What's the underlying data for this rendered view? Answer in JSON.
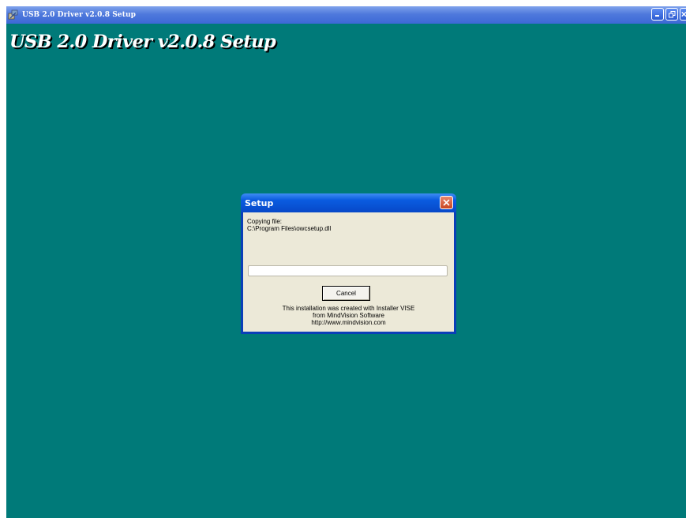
{
  "window": {
    "title": "USB 2.0 Driver v2.0.8 Setup",
    "background_color": "#007a79",
    "controls": [
      "minimize-icon",
      "restore-icon",
      "close-icon"
    ]
  },
  "heading": {
    "text": "USB 2.0 Driver v2.0.8 Setup"
  },
  "dialog": {
    "title": "Setup",
    "copying_label": "Copying file:",
    "file_path": "C:\\Program Files\\owcsetup.dll",
    "progress": 0,
    "cancel_label": "Cancel",
    "credits": [
      "This installation was created with Installer VISE",
      "from MindVision Software",
      "http://www.mindvision.com"
    ]
  }
}
